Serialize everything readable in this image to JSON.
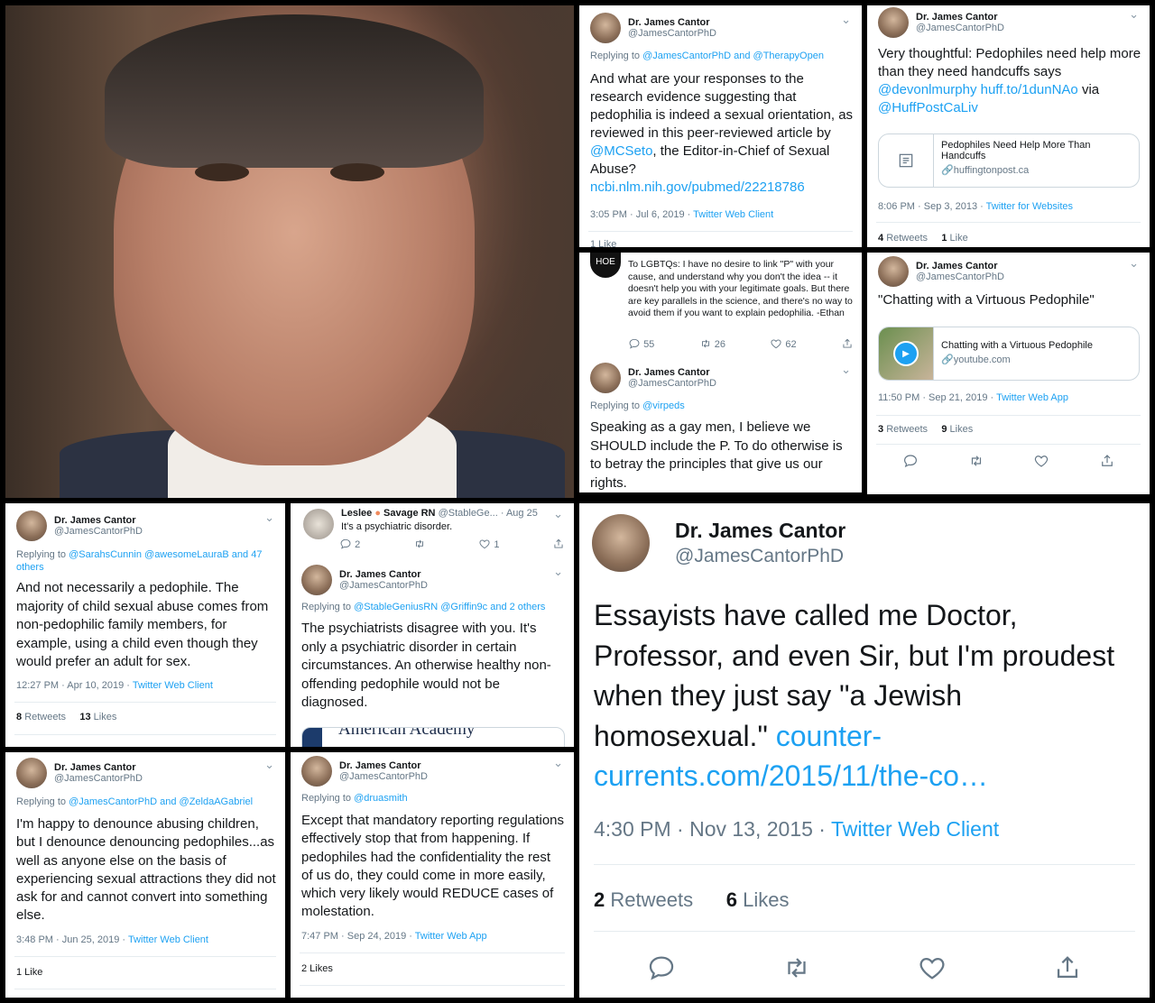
{
  "author": {
    "name": "Dr. James Cantor",
    "handle": "@JamesCantorPhD"
  },
  "tweet1": {
    "replying_prefix": "Replying to ",
    "replying_to": "@JamesCantorPhD and @TherapyOpen",
    "text_a": "And what are your responses to the research evidence suggesting that pedophilia is indeed a sexual orientation, as reviewed in this peer-reviewed article by ",
    "mention": "@MCSeto",
    "text_b": ", the Editor-in-Chief of Sexual Abuse?",
    "url": "ncbi.nlm.nih.gov/pubmed/22218786",
    "time": "3:05 PM · Jul 6, 2019 · ",
    "client": "Twitter Web Client",
    "likes": "1 Like"
  },
  "tweet2": {
    "text_a": "Very thoughtful: Pedophiles need help more than they need handcuffs says ",
    "mention1": "@devonlmurphy",
    "url": "huff.to/1dunNAo",
    "via": " via ",
    "mention2": "@HuffPostCaLiv",
    "card_title": "Pedophiles Need Help More Than Handcuffs",
    "card_site": "huffingtonpost.ca",
    "time": "8:06 PM · Sep 3, 2013 · ",
    "client": "Twitter for Websites",
    "retweets_n": "4",
    "retweets_l": "Retweets",
    "likes_n": "1",
    "likes_l": "Like"
  },
  "tweet3": {
    "quoted_text": "To LGBTQs: I have no desire to link \"P\" with your cause, and understand why you don't the idea -- it doesn't help you with your legitimate goals. But there are key parallels in the science, and there's no way to avoid them if you want to explain pedophilia.  -Ethan",
    "q_replies": "55",
    "q_retweets": "26",
    "q_likes": "62",
    "replying_prefix": "Replying to ",
    "replying_to": "@virpeds",
    "text": "Speaking as a gay men, I believe we SHOULD include the P.  To do otherwise is to betray the principles that give us our rights."
  },
  "tweet4": {
    "text": "\"Chatting with a Virtuous Pedophile\"",
    "card_title": "Chatting with a Virtuous Pedophile",
    "card_site": "youtube.com",
    "time": "11:50 PM · Sep 21, 2019 · ",
    "client": "Twitter Web App",
    "retweets_n": "3",
    "retweets_l": "Retweets",
    "likes_n": "9",
    "likes_l": "Likes"
  },
  "tweet5": {
    "replying_prefix": "Replying to ",
    "replying_to": "@SarahsCunnin @awesomeLauraB and 47 others",
    "text": "And not necessarily a pedophile.  The majority of child sexual abuse comes from non-pedophilic family members, for example, using a child even though they would prefer an adult for sex.",
    "time": "12:27 PM · Apr 10, 2019 · ",
    "client": "Twitter Web Client",
    "retweets_n": "8",
    "retweets_l": "Retweets",
    "likes_n": "13",
    "likes_l": "Likes"
  },
  "tweet6": {
    "q_name": "Leslee",
    "q_name2": "Savage RN",
    "q_handle": "@StableGe...",
    "q_date": "· Aug 25",
    "q_text": "It's a psychiatric disorder.",
    "q_replies": "2",
    "q_likes": "1",
    "replying_prefix": "Replying to ",
    "replying_to": "@StableGeniusRN @Griffin9c and 2 others",
    "text": "The psychiatrists disagree with you.  It's only a psychiatric disorder in certain circumstances.  An otherwise healthy non-offending pedophile would not be diagnosed.",
    "card_peek": "American Academy"
  },
  "tweet7": {
    "replying_prefix": "Replying to ",
    "replying_to": "@JamesCantorPhD and @ZeldaAGabriel",
    "text": "I'm happy to denounce abusing children, but I denounce denouncing pedophiles...as well as anyone else on the basis of experiencing sexual attractions they did not ask for and cannot convert into something else.",
    "time": "3:48 PM · Jun 25, 2019 · ",
    "client": "Twitter Web Client",
    "likes": "1 Like"
  },
  "tweet8": {
    "replying_prefix": "Replying to ",
    "replying_to": "@druasmith",
    "text": "Except that mandatory reporting regulations effectively stop that from happening.  If pedophiles had the confidentiality the rest of us do, they could come in more easily, which very likely would REDUCE cases of molestation.",
    "time": "7:47 PM · Sep 24, 2019 · ",
    "client": "Twitter Web App",
    "likes": "2 Likes"
  },
  "tweet9": {
    "text_a": "Essayists have called me Doctor, Professor, and even Sir, but I'm proudest when they just say \"a Jewish homosexual.\" ",
    "url": "counter-currents.com/2015/11/the-co…",
    "time": "4:30 PM · Nov 13, 2015 · ",
    "client": "Twitter Web Client",
    "retweets_n": "2",
    "retweets_l": "Retweets",
    "likes_n": "6",
    "likes_l": "Likes"
  },
  "icons": [
    "reply-icon",
    "retweet-icon",
    "like-icon",
    "share-icon",
    "chevron-down-icon",
    "link-icon",
    "play-icon",
    "article-icon"
  ],
  "colors": {
    "link": "#1da1f2",
    "muted": "#657786",
    "border": "#000000"
  }
}
